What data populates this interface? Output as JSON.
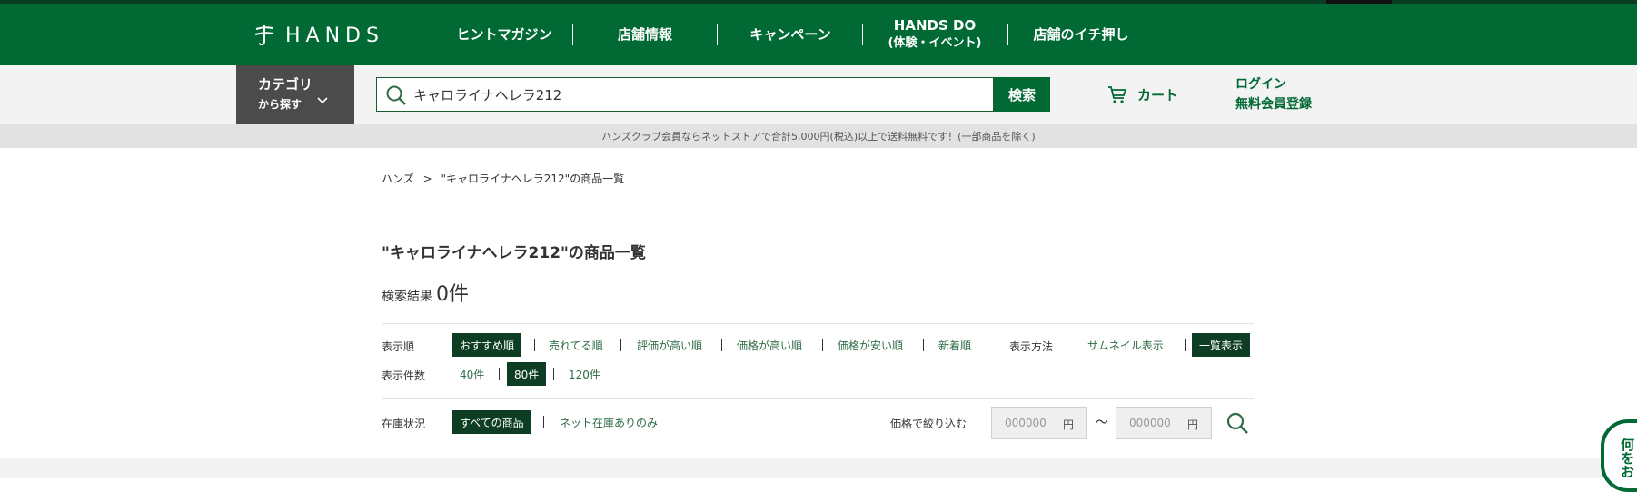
{
  "header": {
    "logo_text": "HANDS",
    "nav": [
      {
        "label": "ヒントマガジン"
      },
      {
        "label": "店舗情報"
      },
      {
        "label": "キャンペーン"
      },
      {
        "label_line1": "HANDS DO",
        "label_line2": "(体験・イベント)"
      },
      {
        "label": "店舗のイチ押し"
      }
    ]
  },
  "searchbar": {
    "category_line1": "カテゴリ",
    "category_line2": "から探す",
    "query": "キャロライナヘレラ212",
    "search_button": "検索",
    "cart_label": "カート",
    "login_label": "ログイン",
    "register_label": "無料会員登録"
  },
  "notice": "ハンズクラブ会員ならネットストアで合計5,000円(税込)以上で送料無料です！(一部商品を除く)",
  "breadcrumb": {
    "home": "ハンズ",
    "separator": ">",
    "current": "\"キャロライナヘレラ212\"の商品一覧"
  },
  "page_title": "\"キャロライナヘレラ212\"の商品一覧",
  "result": {
    "label": "検索結果",
    "count": "0件"
  },
  "sort": {
    "label": "表示順",
    "options": [
      "おすすめ順",
      "売れてる順",
      "評価が高い順",
      "価格が高い順",
      "価格が安い順",
      "新着順"
    ],
    "active": "おすすめ順"
  },
  "view": {
    "label": "表示方法",
    "options": [
      "サムネイル表示",
      "一覧表示"
    ],
    "active": "一覧表示"
  },
  "per_page": {
    "label": "表示件数",
    "options": [
      "40件",
      "80件",
      "120件"
    ],
    "active": "80件"
  },
  "stock": {
    "label": "在庫状況",
    "options": [
      "すべての商品",
      "ネット在庫ありのみ"
    ],
    "active": "すべての商品"
  },
  "price_filter": {
    "label": "価格で絞り込む",
    "min_placeholder": "000000",
    "max_placeholder": "000000",
    "unit": "円",
    "tilde": "〜"
  },
  "float_tab": "何をお"
}
